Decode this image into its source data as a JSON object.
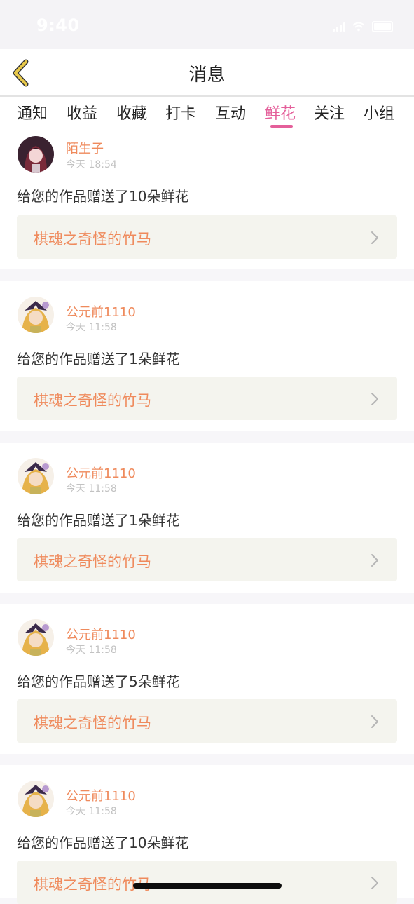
{
  "status_bar": {
    "time": "9:40"
  },
  "header": {
    "title": "消息"
  },
  "tabs": [
    {
      "label": "通知",
      "active": false
    },
    {
      "label": "收益",
      "active": false
    },
    {
      "label": "收藏",
      "active": false
    },
    {
      "label": "打卡",
      "active": false
    },
    {
      "label": "互动",
      "active": false
    },
    {
      "label": "鲜花",
      "active": true
    },
    {
      "label": "关注",
      "active": false
    },
    {
      "label": "小组",
      "active": false
    }
  ],
  "messages": [
    {
      "username": "陌生子",
      "time": "今天 18:54",
      "text": "给您的作品赠送了10朵鲜花",
      "work_title": "棋魂之奇怪的竹马"
    },
    {
      "username": "公元前1110",
      "time": "今天 11:58",
      "text": "给您的作品赠送了1朵鲜花",
      "work_title": "棋魂之奇怪的竹马"
    },
    {
      "username": "公元前1110",
      "time": "今天 11:58",
      "text": "给您的作品赠送了1朵鲜花",
      "work_title": "棋魂之奇怪的竹马"
    },
    {
      "username": "公元前1110",
      "time": "今天 11:58",
      "text": "给您的作品赠送了5朵鲜花",
      "work_title": "棋魂之奇怪的竹马"
    },
    {
      "username": "公元前1110",
      "time": "今天 11:58",
      "text": "给您的作品赠送了10朵鲜花",
      "work_title": "棋魂之奇怪的竹马"
    }
  ],
  "colors": {
    "accent": "#e45f9a",
    "username": "#ef8a5c",
    "back_icon": "#e7c84a",
    "work_card_bg": "#f4f4ee"
  },
  "icons": {
    "back": "chevron-left-icon",
    "work_link": "chevron-right-icon"
  }
}
